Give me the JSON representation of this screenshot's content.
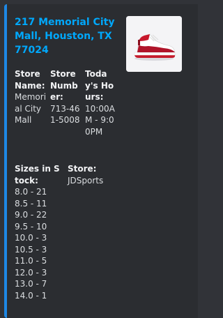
{
  "embed": {
    "title": "217 Memorial City Mall, Houston, TX 77024",
    "accent_color": "#1e88e5",
    "thumbnail": "red-white-sneaker-image"
  },
  "fields": [
    {
      "name": "Store Name:",
      "value": "Memorial City Mall"
    },
    {
      "name": "Store Number:",
      "value": "713-461-5008"
    },
    {
      "name": "Today's Hours:",
      "value": "10:00AM - 9:00PM"
    }
  ],
  "sizes": {
    "name": "Sizes in Stock:",
    "items": [
      "8.0 - 21",
      "8.5 - 11",
      "9.0 - 22",
      "9.5 - 10",
      "10.0 - 3",
      "10.5 - 3",
      "11.0 - 5",
      "12.0 - 3",
      "13.0 - 7",
      "14.0 - 1"
    ]
  },
  "store": {
    "name": "Store:",
    "value": "JDSports"
  }
}
